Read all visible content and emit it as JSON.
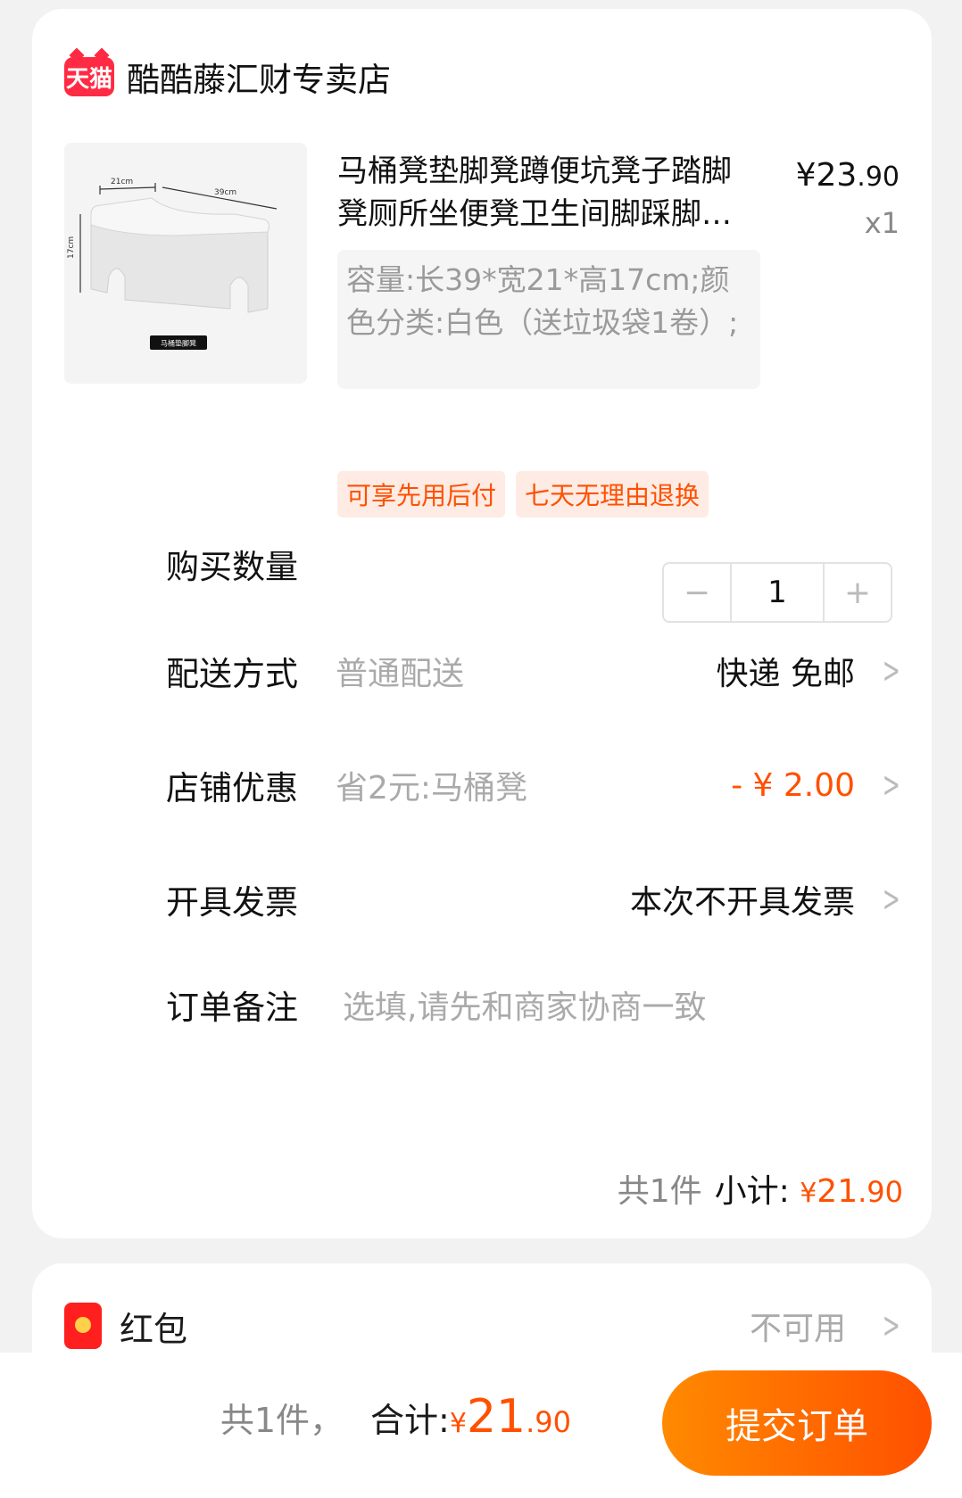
{
  "store": {
    "logo_text": "天猫",
    "name": "酷酷藤汇财专卖店"
  },
  "product": {
    "image_labels": {
      "width": "21cm",
      "length": "39cm",
      "height": "17cm",
      "caption": "马桶垫脚凳"
    },
    "title": "马桶凳垫脚凳蹲便坑凳子踏脚凳厕所坐便凳卫生间脚踩脚…",
    "price_currency": "¥",
    "price_int": "23",
    "price_dec": ".90",
    "qty": "x1",
    "spec": "容量:长39*宽21*高17cm;颜色分类:白色（送垃圾袋1卷）;",
    "tags": [
      "可享先用后付",
      "七天无理由退换"
    ]
  },
  "quantity": {
    "label": "购买数量",
    "minus": "−",
    "value": "1",
    "plus": "+"
  },
  "delivery": {
    "label": "配送方式",
    "sub": "普通配送",
    "value": "快递 免邮"
  },
  "discount": {
    "label": "店铺优惠",
    "sub": "省2元:马桶凳",
    "value": "- ¥ 2.00"
  },
  "invoice": {
    "label": "开具发票",
    "value": "本次不开具发票"
  },
  "remark": {
    "label": "订单备注",
    "placeholder": "选填,请先和商家协商一致"
  },
  "subtotal": {
    "count": "共1件",
    "label": "小计:",
    "currency": "¥",
    "int": "21",
    "dec": ".90"
  },
  "redpacket": {
    "label": "红包",
    "value": "不可用"
  },
  "footer": {
    "count": "共1件，",
    "label": "合计:",
    "currency": "¥",
    "int": "21",
    "dec": ".90",
    "submit": "提交订单"
  },
  "colors": {
    "accent": "#ff5000",
    "brand_red": "#ff2a44"
  }
}
